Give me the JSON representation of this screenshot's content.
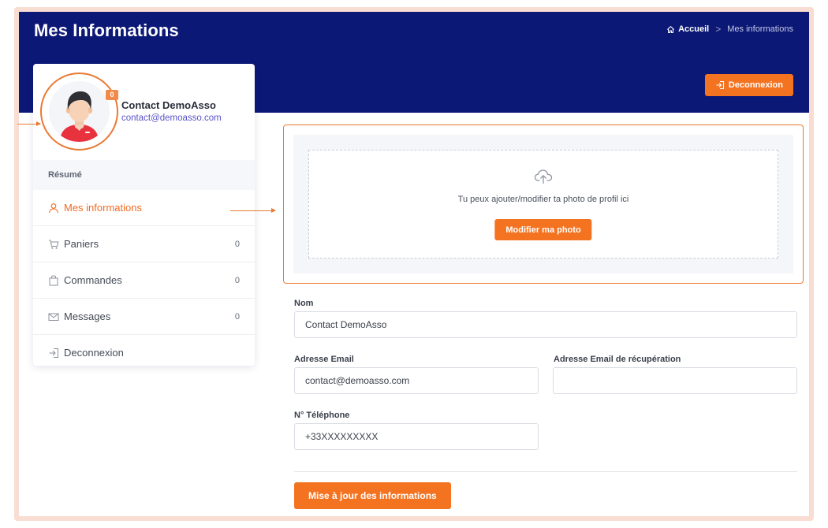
{
  "header": {
    "title": "Mes Informations",
    "breadcrumb": {
      "home": "Accueil",
      "separator": ">",
      "current": "Mes informations"
    },
    "logout_label": "Deconnexion"
  },
  "profile": {
    "badge_count": "0",
    "name": "Contact DemoAsso",
    "email": "contact@demoasso.com"
  },
  "sidebar": {
    "section_title": "Résumé",
    "items": [
      {
        "label": "Mes informations",
        "count": "",
        "icon": "user-icon",
        "active": true
      },
      {
        "label": "Paniers",
        "count": "0",
        "icon": "cart-icon"
      },
      {
        "label": "Commandes",
        "count": "0",
        "icon": "bag-icon"
      },
      {
        "label": "Messages",
        "count": "0",
        "icon": "envelope-icon"
      },
      {
        "label": "Deconnexion",
        "count": "",
        "icon": "logout-icon"
      }
    ]
  },
  "upload": {
    "text": "Tu peux ajouter/modifier ta photo de profil ici",
    "button_label": "Modifier ma photo",
    "icon": "cloud-upload-icon"
  },
  "form": {
    "nom_label": "Nom",
    "nom_value": "Contact DemoAsso",
    "email_label": "Adresse Email",
    "email_value": "contact@demoasso.com",
    "recovery_label": "Adresse Email de récupération",
    "recovery_value": "",
    "phone_label": "N° Téléphone",
    "phone_value": "+33XXXXXXXXX",
    "submit_label": "Mise à jour des informations"
  },
  "colors": {
    "header_bg": "#0c1876",
    "accent": "#f47321",
    "highlight_outline": "#e97a34",
    "frame": "#f9dcd2"
  }
}
